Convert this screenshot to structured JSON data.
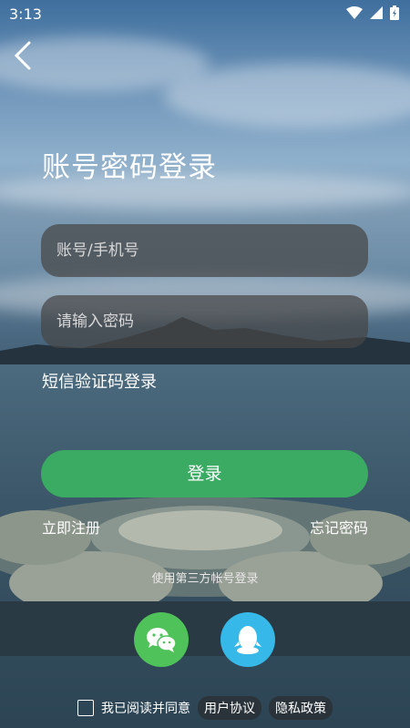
{
  "status_bar": {
    "time": "3:13"
  },
  "page": {
    "title": "账号密码登录"
  },
  "form": {
    "account_placeholder": "账号/手机号",
    "password_placeholder": "请输入密码",
    "sms_login_label": "短信验证码登录",
    "login_button": "登录",
    "register_label": "立即注册",
    "forgot_label": "忘记密码",
    "third_party_label": "使用第三方帐号登录"
  },
  "social": [
    {
      "name": "wechat",
      "icon": "wechat-icon",
      "color": "#4fc25a"
    },
    {
      "name": "qq",
      "icon": "qq-icon",
      "color": "#36b9e8"
    }
  ],
  "agreement": {
    "text": "我已阅读并同意",
    "user_agreement": "用户协议",
    "privacy_policy": "隐私政策",
    "checked": false
  },
  "colors": {
    "accent": "#3bab63"
  }
}
